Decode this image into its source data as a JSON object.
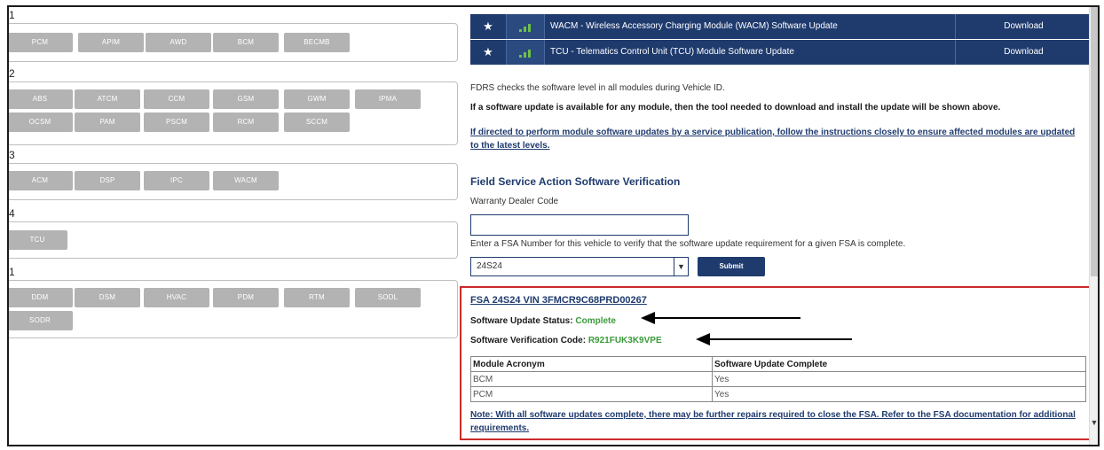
{
  "groups": [
    {
      "label": "1",
      "modules": [
        "PCM",
        "APIM",
        "AWD",
        "BCM",
        "BECMB"
      ]
    },
    {
      "label": "2",
      "modules": [
        "ABS",
        "ATCM",
        "CCM",
        "GSM",
        "GWM",
        "IPMA",
        "OCSM",
        "PAM",
        "PSCM",
        "RCM",
        "SCCM"
      ]
    },
    {
      "label": "3",
      "modules": [
        "ACM",
        "DSP",
        "IPC",
        "WACM"
      ]
    },
    {
      "label": "4",
      "modules": [
        "TCU"
      ]
    },
    {
      "label": "1",
      "modules": [
        "DDM",
        "DSM",
        "HVAC",
        "PDM",
        "RTM",
        "SODL",
        "SODR"
      ]
    }
  ],
  "downloads": [
    {
      "title": "WACM - Wireless Accessory Charging Module (WACM) Software Update",
      "action": "Download"
    },
    {
      "title": "TCU - Telematics Control Unit (TCU) Module Software Update",
      "action": "Download"
    }
  ],
  "info": {
    "line1": "FDRS checks the software level in all modules during Vehicle ID.",
    "line2": "If a software update is available for any module, then the tool needed to download and install the update will be shown above.",
    "line3": "If directed to perform module software updates by a service publication, follow the instructions closely to ensure affected modules are updated to the latest levels."
  },
  "fsa": {
    "section_title": "Field Service Action Software Verification",
    "dealer_label": "Warranty Dealer Code",
    "dealer_value": "",
    "instruction": "Enter a FSA Number for this vehicle to verify that the software update requirement for a given FSA is complete.",
    "selected": "24S24",
    "submit_label": "Submit"
  },
  "result": {
    "title": "FSA 24S24 VIN 3FMCR9C68PRD00267",
    "status_label": "Software Update Status:",
    "status_value": "Complete",
    "code_label": "Software Verification Code:",
    "code_value": "R921FUK3K9VPE",
    "columns": [
      "Module Acronym",
      "Software Update Complete"
    ],
    "rows": [
      [
        "BCM",
        "Yes"
      ],
      [
        "PCM",
        "Yes"
      ]
    ],
    "note": "Note: With all software updates complete, there may be further repairs required to close the FSA. Refer to the FSA documentation for additional requirements."
  },
  "icons": {
    "star": "star-icon",
    "signal": "signal-icon",
    "dropdown": "chevron-down-icon"
  },
  "colors": {
    "navy": "#1f3b6e",
    "module_gray": "#b3b3b3",
    "highlight_red": "#cc2a2a",
    "status_green": "#3a9a3a"
  }
}
